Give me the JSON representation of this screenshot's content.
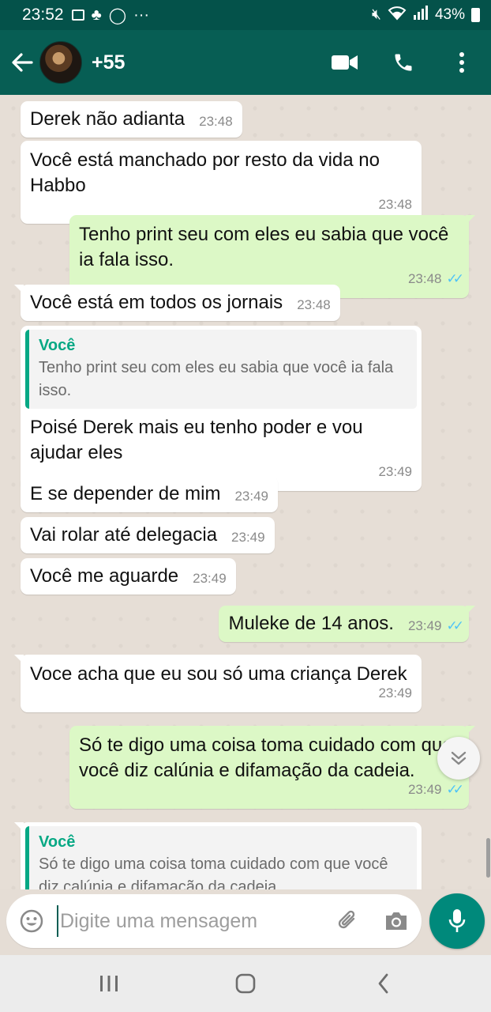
{
  "status_bar": {
    "time": "23:52",
    "battery": "43%"
  },
  "header": {
    "contact_name": "+55"
  },
  "messages": [
    {
      "dir": "in",
      "text": "Derek não adianta",
      "time": "23:48"
    },
    {
      "dir": "in",
      "text": "Você está manchado por resto da vida no Habbo",
      "time": "23:48"
    },
    {
      "dir": "out",
      "text": "Tenho print seu com eles eu sabia que você ia fala isso.",
      "time": "23:48",
      "status": "read"
    },
    {
      "dir": "in",
      "text": "Você está em todos os jornais",
      "time": "23:48"
    },
    {
      "dir": "in",
      "quote": {
        "author": "Você",
        "text": "Tenho print seu com eles eu sabia que você ia fala isso."
      },
      "text": "Poisé Derek mais eu tenho poder e vou ajudar eles",
      "time": "23:49"
    },
    {
      "dir": "in",
      "text": "E se depender de mim",
      "time": "23:49"
    },
    {
      "dir": "in",
      "text": "Vai rolar até delegacia",
      "time": "23:49"
    },
    {
      "dir": "in",
      "text": "Você me aguarde",
      "time": "23:49"
    },
    {
      "dir": "out",
      "text": "Muleke de 14 anos.",
      "time": "23:49",
      "status": "read"
    },
    {
      "dir": "in",
      "text": "Voce acha que eu sou só uma criança Derek",
      "time": "23:49"
    },
    {
      "dir": "out",
      "text": "Só te digo uma coisa toma cuidado com que você diz calúnia e difamação da cadeia.",
      "time": "23:49",
      "status": "read"
    },
    {
      "dir": "in",
      "quote": {
        "author": "Você",
        "text": "Só te digo uma coisa toma cuidado com que você diz calúnia e difamação da cadeia."
      },
      "text": ""
    }
  ],
  "composer": {
    "placeholder": "Digite uma mensagem"
  },
  "colors": {
    "header": "#075e54",
    "status_bar": "#04524a",
    "outgoing_bubble": "#dcf8c6",
    "incoming_bubble": "#ffffff",
    "accent": "#00897b",
    "read_ticks": "#4fc3f7"
  },
  "icons": [
    "back-arrow-icon",
    "video-call-icon",
    "phone-icon",
    "more-options-icon",
    "scroll-down-icon",
    "emoji-icon",
    "attach-icon",
    "camera-icon",
    "mic-icon",
    "nav-recents-icon",
    "nav-home-icon",
    "nav-back-icon"
  ]
}
